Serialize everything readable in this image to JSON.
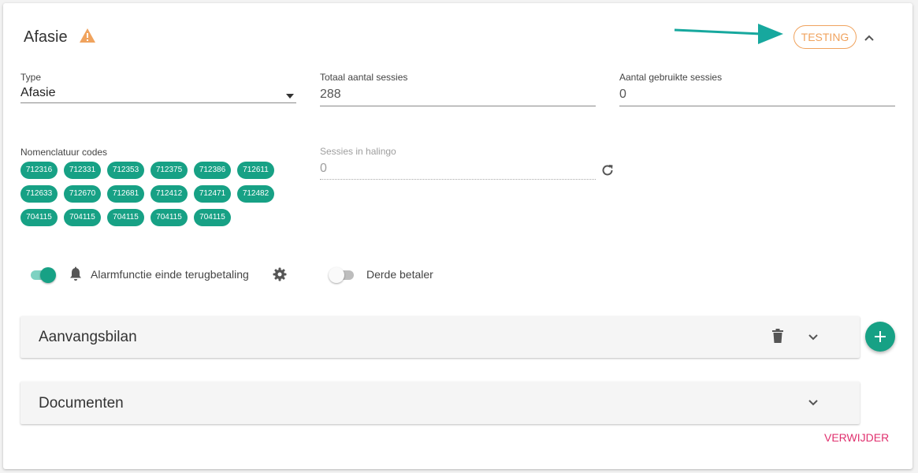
{
  "header": {
    "title": "Afasie",
    "status_chip": "TESTING"
  },
  "fields": {
    "type": {
      "label": "Type",
      "value": "Afasie"
    },
    "total_sessions": {
      "label": "Totaal aantal sessies",
      "value": "288"
    },
    "used_sessions": {
      "label": "Aantal gebruikte sessies",
      "value": "0"
    },
    "halingo_sessions": {
      "label": "Sessies in halingo",
      "value": "0"
    }
  },
  "nomenclature": {
    "label": "Nomenclatuur codes",
    "codes": [
      "712316",
      "712331",
      "712353",
      "712375",
      "712386",
      "712611",
      "712633",
      "712670",
      "712681",
      "712412",
      "712471",
      "712482",
      "704115",
      "704115",
      "704115",
      "704115",
      "704115"
    ]
  },
  "toggles": {
    "alarm": {
      "label": "Alarmfunctie einde terugbetaling",
      "on": true
    },
    "third_party": {
      "label": "Derde betaler",
      "on": false
    }
  },
  "panels": {
    "aanvangsbilan": {
      "title": "Aanvangsbilan"
    },
    "documenten": {
      "title": "Documenten"
    }
  },
  "actions": {
    "delete_label": "VERWIJDER"
  },
  "icons": [
    "warning-icon",
    "arrow-icon",
    "chevron-up-icon",
    "caret-down-icon",
    "refresh-icon",
    "bell-icon",
    "gear-icon",
    "trash-icon",
    "chevron-down-icon",
    "plus-icon"
  ],
  "colors": {
    "primary": "#17a185",
    "warning": "#f0a35e",
    "danger": "#e0306e",
    "arrow": "#17a89e"
  }
}
